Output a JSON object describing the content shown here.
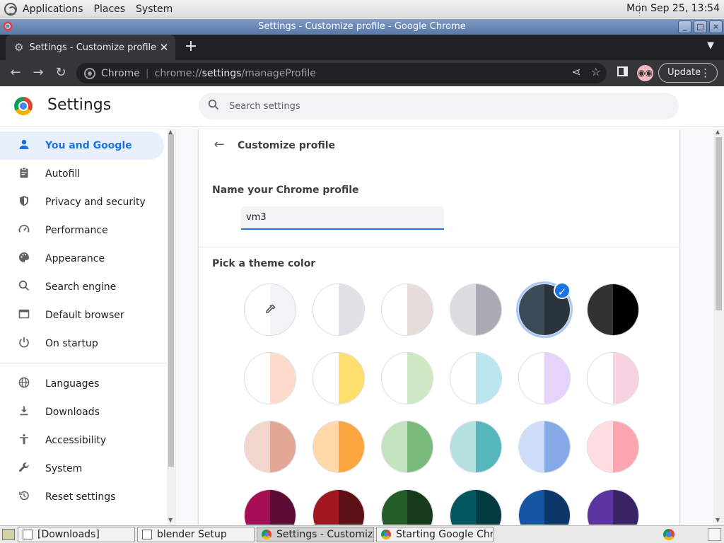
{
  "top_panel": {
    "menus": [
      "Applications",
      "Places",
      "System"
    ],
    "clock": "Mon Sep 25, 13:54"
  },
  "window": {
    "title": "Settings - Customize profile - Google Chrome",
    "controls": [
      "minimize",
      "maximize",
      "close"
    ]
  },
  "browser": {
    "tab_title": "Settings - Customize profile",
    "omnibox": {
      "site_label": "Chrome",
      "url_scheme": "chrome://",
      "url_host": "settings",
      "url_path": "/manageProfile"
    },
    "update_label": "Update"
  },
  "settings": {
    "title": "Settings",
    "search_placeholder": "Search settings",
    "nav": [
      {
        "label": "You and Google",
        "icon": "person-icon",
        "active": true
      },
      {
        "label": "Autofill",
        "icon": "clipboard-icon"
      },
      {
        "label": "Privacy and security",
        "icon": "shield-icon"
      },
      {
        "label": "Performance",
        "icon": "speedometer-icon"
      },
      {
        "label": "Appearance",
        "icon": "palette-icon"
      },
      {
        "label": "Search engine",
        "icon": "search-icon"
      },
      {
        "label": "Default browser",
        "icon": "browser-window-icon"
      },
      {
        "label": "On startup",
        "icon": "power-icon"
      },
      {
        "label": "Languages",
        "icon": "globe-icon"
      },
      {
        "label": "Downloads",
        "icon": "download-icon"
      },
      {
        "label": "Accessibility",
        "icon": "accessibility-icon"
      },
      {
        "label": "System",
        "icon": "wrench-icon"
      },
      {
        "label": "Reset settings",
        "icon": "history-icon"
      }
    ]
  },
  "customize_profile": {
    "heading": "Customize profile",
    "name_label": "Name your Chrome profile",
    "name_value": "vm3",
    "theme_label": "Pick a theme color",
    "selected_theme_index": 4,
    "themes": [
      {
        "left": "#ffffff",
        "right": "#f1f3f4",
        "custom_picker": true
      },
      {
        "left": "#ffffff",
        "right": "#dee1e6"
      },
      {
        "left": "#ffffff",
        "right": "#e6dcda"
      },
      {
        "left": "#dadce0",
        "right": "#a8abb3"
      },
      {
        "left": "#3c4b58",
        "right": "#2a343d"
      },
      {
        "left": "#323232",
        "right": "#000000"
      },
      {
        "left": "#ffffff",
        "right": "#fcdbcb"
      },
      {
        "left": "#ffffff",
        "right": "#fcdf6d"
      },
      {
        "left": "#ffffff",
        "right": "#cde8c3"
      },
      {
        "left": "#ffffff",
        "right": "#bae6ef"
      },
      {
        "left": "#ffffff",
        "right": "#e6d3f9"
      },
      {
        "left": "#ffffff",
        "right": "#f7d3e1"
      },
      {
        "left": "#f2d6cd",
        "right": "#e2a796"
      },
      {
        "left": "#ffd7a8",
        "right": "#fba53e"
      },
      {
        "left": "#c2e2c0",
        "right": "#7aba7a"
      },
      {
        "left": "#b4e0e0",
        "right": "#56b7bd"
      },
      {
        "left": "#cfdcf7",
        "right": "#86a9e8"
      },
      {
        "left": "#ffdbe2",
        "right": "#fba5b1"
      },
      {
        "left": "#a60d55",
        "right": "#5c0b34"
      },
      {
        "left": "#a0171d",
        "right": "#5d1114"
      },
      {
        "left": "#255d2a",
        "right": "#173a1b"
      },
      {
        "left": "#04575e",
        "right": "#043b40"
      },
      {
        "left": "#1556a2",
        "right": "#0e3769"
      },
      {
        "left": "#5b36a0",
        "right": "#3a2466"
      }
    ]
  },
  "taskbar": {
    "tasks": [
      {
        "label": "[Downloads]",
        "icon": "folder-icon"
      },
      {
        "label": "blender Setup",
        "icon": "window-icon"
      },
      {
        "label": "Settings - Customiz...",
        "icon": "chrome-icon",
        "active": true
      },
      {
        "label": "Starting Google Chr...",
        "icon": "chrome-icon"
      }
    ]
  }
}
